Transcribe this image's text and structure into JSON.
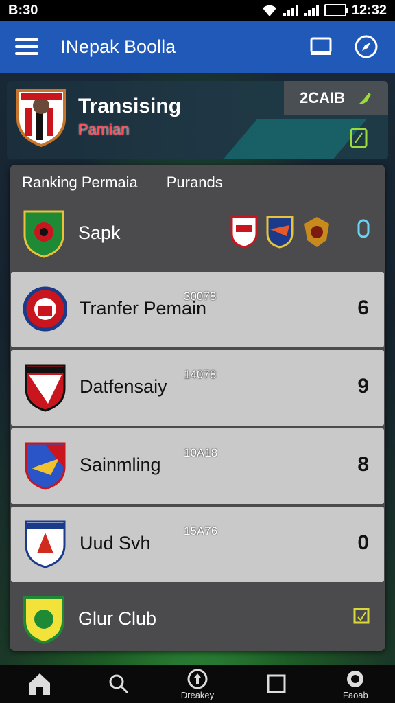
{
  "status_bar": {
    "left_text": "B:30",
    "time": "12:32"
  },
  "app_bar": {
    "title": "INepak Boolla"
  },
  "hero": {
    "title": "Transising",
    "subtitle": "Pamian",
    "chip_label": "2CAIB"
  },
  "panel": {
    "header_tabs": [
      "Ranking Permaia",
      "Purands"
    ],
    "rows": [
      {
        "name": "Sapk",
        "value": "",
        "number": "0"
      },
      {
        "name": "Tranfer Pemain",
        "value": "30078",
        "number": "6"
      },
      {
        "name": "Datfensaiy",
        "value": "14078",
        "number": "9"
      },
      {
        "name": "Sainmling",
        "value": "10A18",
        "number": "8"
      },
      {
        "name": "Uud Svh",
        "value": "15A76",
        "number": "0"
      },
      {
        "name": "Glur Club",
        "value": "",
        "number": ""
      }
    ]
  },
  "bottom_nav": {
    "items": [
      {
        "label": "",
        "icon": "home-icon"
      },
      {
        "label": "",
        "icon": "search-icon"
      },
      {
        "label": "Dreakey",
        "icon": "upload-icon"
      },
      {
        "label": "",
        "icon": "square-icon"
      },
      {
        "label": "Faoab",
        "icon": "settings-icon"
      }
    ]
  },
  "colors": {
    "app_bar": "#2159b8",
    "accent_green": "#9bdc3c",
    "accent_red": "#ff4d57"
  }
}
